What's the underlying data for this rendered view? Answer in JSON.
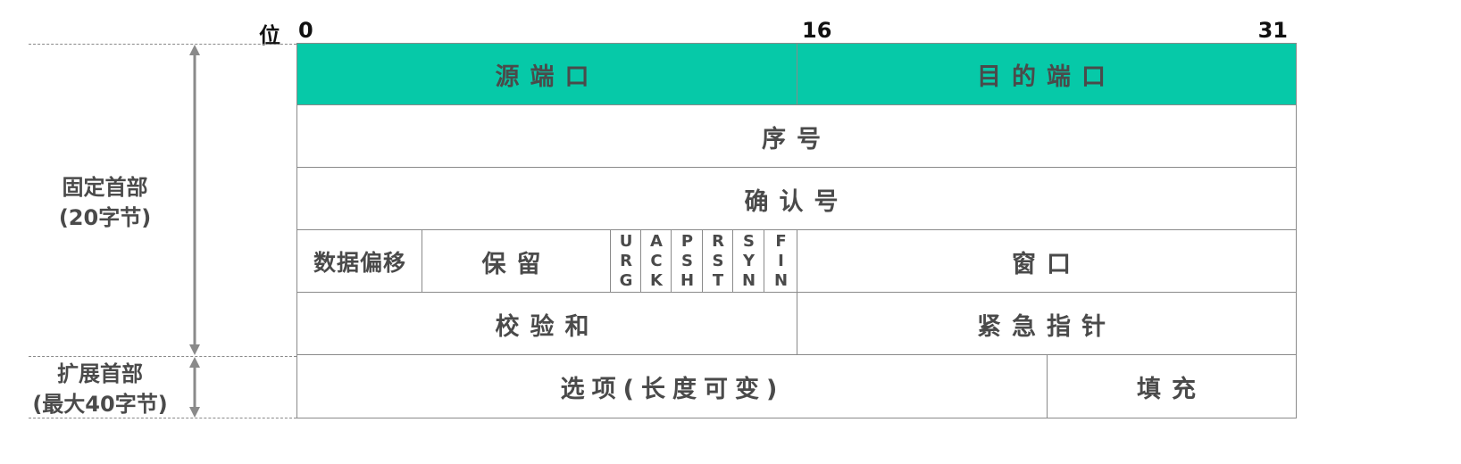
{
  "bit_labels": {
    "prefix": "位",
    "start": "0",
    "middle": "16",
    "end": "31"
  },
  "rows": {
    "source_port": "源端口",
    "dest_port": "目的端口",
    "sequence_number": "序号",
    "ack_number": "确认号",
    "data_offset": "数据偏移",
    "reserved": "保留",
    "window": "窗口",
    "checksum": "校验和",
    "urgent_pointer": "紧急指针",
    "options": "选项(长度可变)",
    "padding": "填充"
  },
  "flags": [
    {
      "chars": [
        "U",
        "R",
        "G"
      ]
    },
    {
      "chars": [
        "A",
        "C",
        "K"
      ]
    },
    {
      "chars": [
        "P",
        "S",
        "H"
      ]
    },
    {
      "chars": [
        "R",
        "S",
        "T"
      ]
    },
    {
      "chars": [
        "S",
        "Y",
        "N"
      ]
    },
    {
      "chars": [
        "F",
        "I",
        "N"
      ]
    }
  ],
  "sections": {
    "fixed_header": {
      "line1": "固定首部",
      "line2": "(20字节)"
    },
    "extended_header": {
      "line1": "扩展首部",
      "line2": "(最大40字节)"
    }
  },
  "colors": {
    "port_fill": "#06c9a8",
    "border": "#8a8a8a",
    "text": "#4a4a4a"
  }
}
